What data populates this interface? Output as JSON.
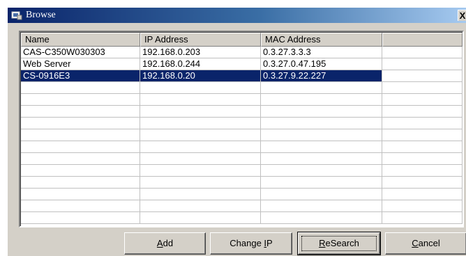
{
  "window": {
    "title": "Browse",
    "close_glyph": "X",
    "title_icon": "browse-window-icon"
  },
  "list": {
    "columns": [
      "Name",
      "IP Address",
      "MAC Address",
      ""
    ],
    "rows": [
      {
        "name": "CAS-C350W030303",
        "ip": "192.168.0.203",
        "mac": "0.3.27.3.3.3",
        "selected": false
      },
      {
        "name": "Web Server",
        "ip": "192.168.0.244",
        "mac": "0.3.27.0.47.195",
        "selected": false
      },
      {
        "name": "CS-0916E3",
        "ip": "192.168.0.20",
        "mac": "0.3.27.9.22.227",
        "selected": true
      }
    ],
    "selection_color": "#0a246a"
  },
  "buttons": {
    "add": {
      "mnemonic": "A",
      "rest": "dd"
    },
    "change_ip": {
      "before": "Change ",
      "mnemonic": "I",
      "rest": "P"
    },
    "research": {
      "mnemonic": "R",
      "rest": "eSearch"
    },
    "cancel": {
      "mnemonic": "C",
      "rest": "ancel"
    }
  }
}
